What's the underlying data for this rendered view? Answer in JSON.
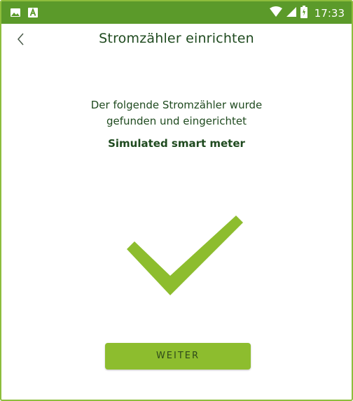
{
  "status_bar": {
    "time": "17:33",
    "left_icons": [
      "image-icon",
      "a-letter-icon"
    ],
    "right_icons": [
      "wifi-icon",
      "cell-signal-icon",
      "battery-icon"
    ]
  },
  "app_bar": {
    "back_icon": "chevron-left-icon",
    "title": "Stromzähler einrichten"
  },
  "content": {
    "message_line1": "Der folgende Stromzähler wurde",
    "message_line2": "gefunden und eingerichtet",
    "meter_name": "Simulated smart meter",
    "success_icon": "checkmark-icon"
  },
  "actions": {
    "continue_label": "WEITER"
  },
  "colors": {
    "status_bar": "#5b9a2a",
    "accent": "#8dbd2e",
    "text": "#1f4a1f",
    "border": "#8dbd3c"
  }
}
